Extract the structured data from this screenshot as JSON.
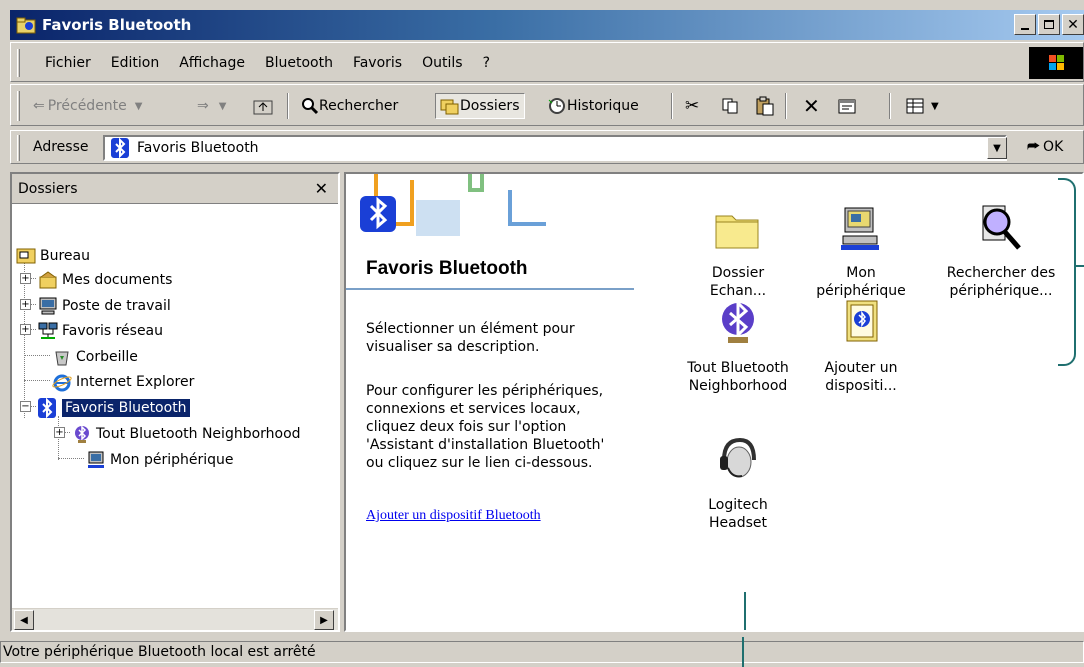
{
  "window": {
    "title": "Favoris Bluetooth"
  },
  "menu": [
    "Fichier",
    "Edition",
    "Affichage",
    "Bluetooth",
    "Favoris",
    "Outils",
    "?"
  ],
  "toolbar": {
    "back": "Précédente",
    "search": "Rechercher",
    "folders": "Dossiers",
    "history": "Historique"
  },
  "address": {
    "label": "Adresse",
    "value": "Favoris Bluetooth",
    "go": "OK"
  },
  "folders_pane": {
    "title": "Dossiers",
    "tree": [
      "Bureau",
      "Mes documents",
      "Poste de travail",
      "Favoris réseau",
      "Corbeille",
      "Internet Explorer",
      "Favoris Bluetooth",
      "Tout Bluetooth Neighborhood",
      "Mon périphérique"
    ]
  },
  "info_panel": {
    "title": "Favoris Bluetooth",
    "text1": "Sélectionner un élément pour visualiser sa description.",
    "text2": "Pour configurer les périphériques, connexions et services locaux, cliquez deux fois sur l'option 'Assistant d'installation Bluetooth' ou cliquez sur le lien ci-dessous.",
    "link": "Ajouter un dispositif Bluetooth"
  },
  "items": {
    "dossier": {
      "line1": "Dossier",
      "line2": "Echan..."
    },
    "peripherique": {
      "line1": "Mon",
      "line2": "périphérique"
    },
    "rechercher": {
      "line1": "Rechercher des",
      "line2": "périphérique..."
    },
    "neighborhood": {
      "line1": "Tout Bluetooth",
      "line2": "Neighborhood"
    },
    "ajouter": {
      "line1": "Ajouter un",
      "line2": "dispositi..."
    },
    "headset": {
      "line1": "Logitech",
      "line2": "Headset"
    }
  },
  "status": {
    "text": "Votre périphérique Bluetooth local est arrêté"
  },
  "colors": {
    "titlebar": "#0a246a",
    "selection": "#0a246a",
    "callout": "#1f6f6f",
    "bluetooth": "#1a3fd6"
  }
}
